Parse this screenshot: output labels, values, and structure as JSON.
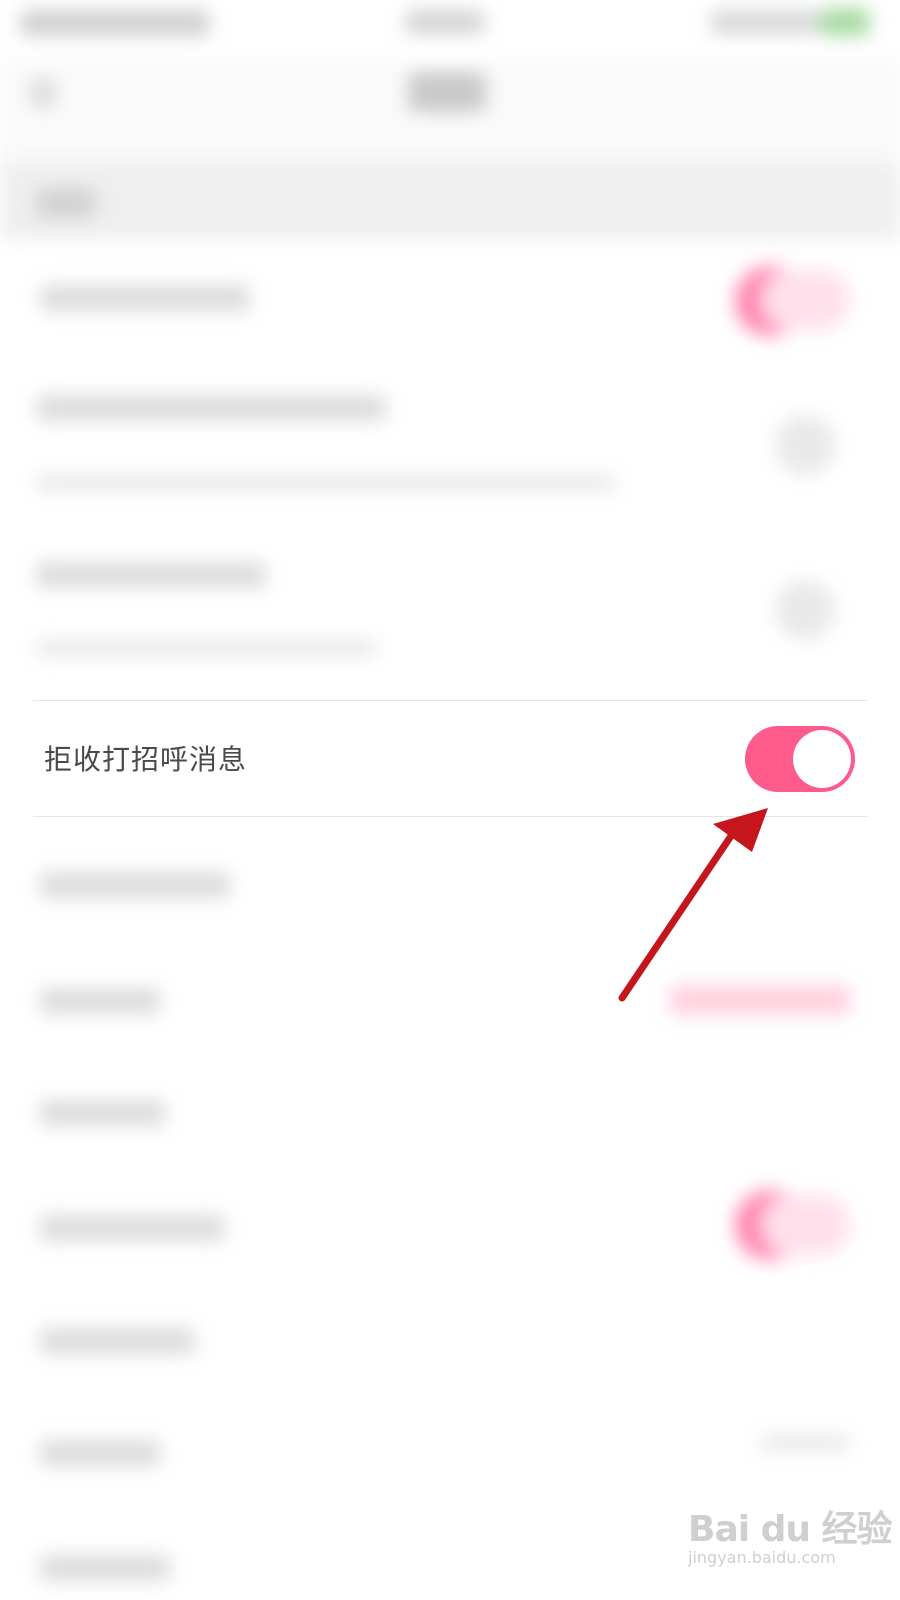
{
  "settings": {
    "reject_greetings": {
      "label": "拒收打招呼消息",
      "enabled": true
    }
  },
  "colors": {
    "toggle_on": "#ff5a8c",
    "arrow": "#c4161c",
    "label": "#4a4a4a"
  },
  "watermark": {
    "logo": "Bai du 经验",
    "url": "jingyan.baidu.com"
  }
}
